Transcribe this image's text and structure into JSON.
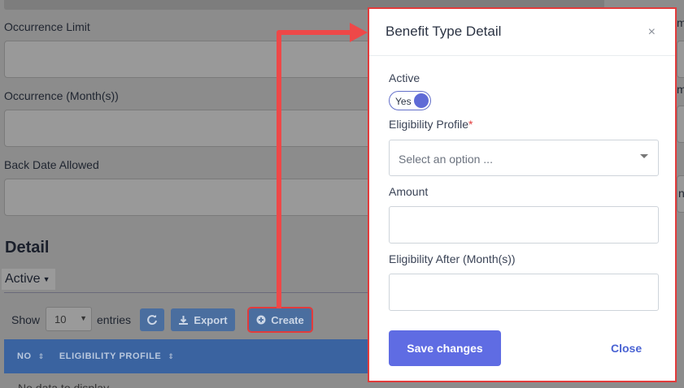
{
  "background": {
    "fields": [
      {
        "label": "Occurrence Limit"
      },
      {
        "label": "Occurrence (Month(s))"
      },
      {
        "label": "Back Date Allowed"
      }
    ],
    "right_fragments": [
      "m",
      "m",
      "n"
    ],
    "section_title": "Detail",
    "tab_label": "Active",
    "show_label": "Show",
    "entries_value": "10",
    "entries_label": "entries",
    "export_label": "Export",
    "create_label": "Create",
    "table_headers": [
      "NO",
      "ELIGIBILITY PROFILE"
    ],
    "no_data": "No data to display"
  },
  "modal": {
    "title": "Benefit Type Detail",
    "close_icon": "×",
    "active_label": "Active",
    "toggle_label": "Yes",
    "eligibility_profile_label": "Eligibility Profile",
    "required_mark": "*",
    "eligibility_profile_placeholder": "Select an option ...",
    "amount_label": "Amount",
    "amount_value": "",
    "eligibility_after_label": "Eligibility After (Month(s))",
    "eligibility_after_value": "",
    "save_label": "Save changes",
    "close_label": "Close"
  },
  "colors": {
    "highlight": "#e23b3b",
    "primary": "#5f6ce3"
  }
}
